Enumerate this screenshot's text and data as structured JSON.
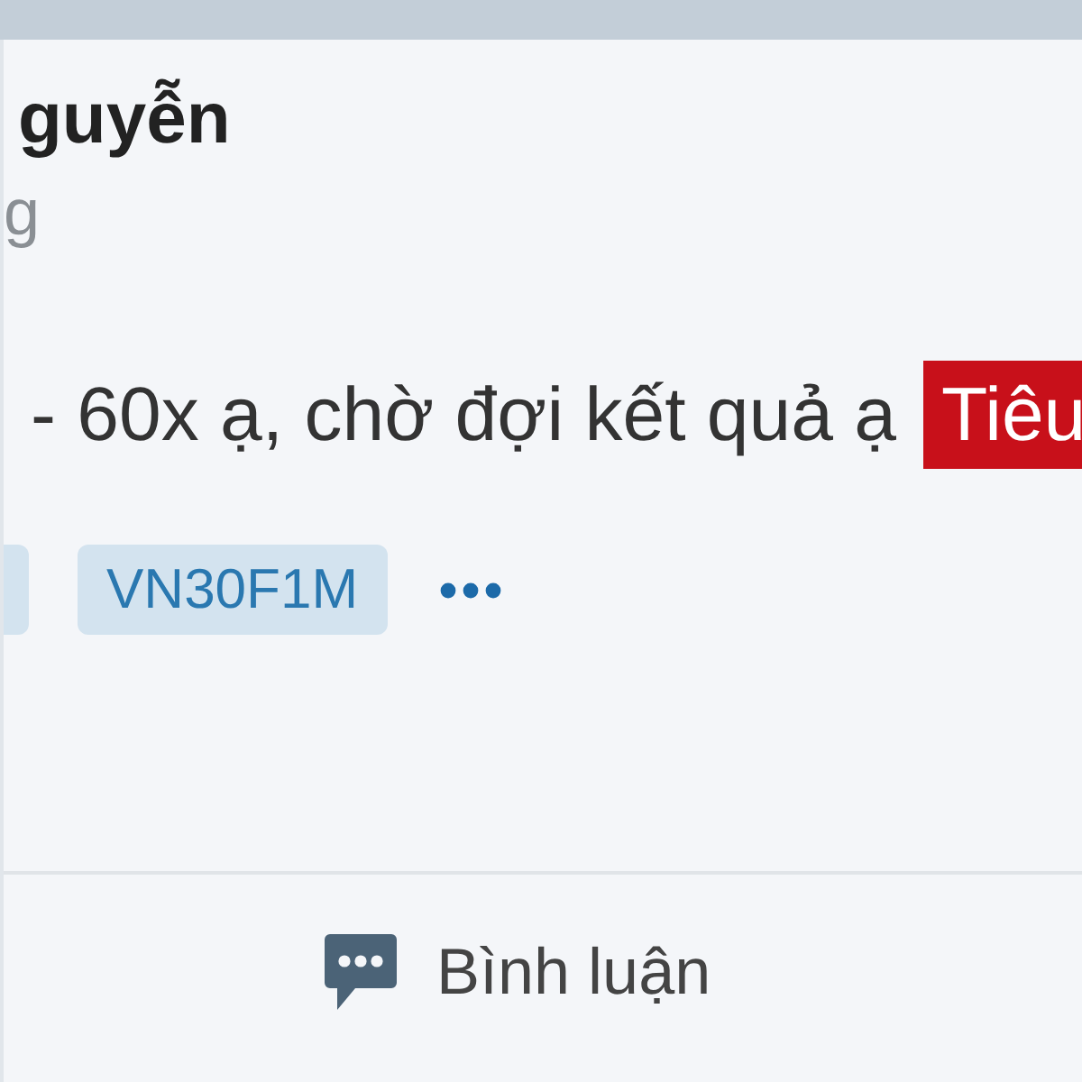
{
  "post": {
    "author": "guyễn",
    "subtitle": "g",
    "text": "- 60x ạ, chờ đợi kết quả ạ",
    "badge": "Tiêu",
    "tags": [
      {
        "clipped": true
      },
      {
        "label": "VN30F1M",
        "clipped": false
      }
    ]
  },
  "comment_button": {
    "label": "Bình luận"
  }
}
